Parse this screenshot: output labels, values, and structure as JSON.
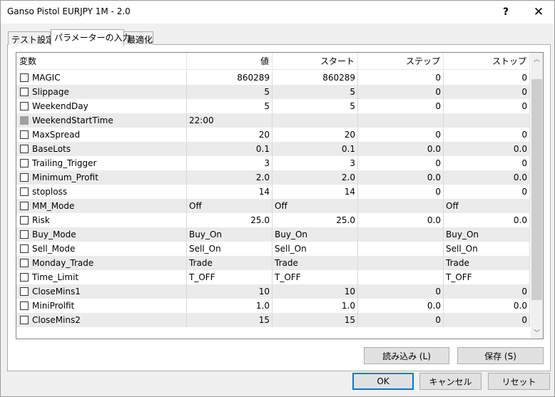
{
  "window": {
    "title": "Ganso Pistol EURJPY 1M - 2.0",
    "help_glyph": "?",
    "close_glyph": "✕"
  },
  "tabs": [
    {
      "label": "テスト設定"
    },
    {
      "label": "パラメーターの入力"
    },
    {
      "label": "最適化"
    }
  ],
  "grid": {
    "headers": {
      "name": "変数",
      "value": "値",
      "start": "スタート",
      "step": "ステップ",
      "stop": "ストップ"
    },
    "rows": [
      {
        "name": "MAGIC",
        "value": "860289",
        "start": "860289",
        "step": "0",
        "stop": "0",
        "align": "num",
        "checked": false,
        "disabled": false
      },
      {
        "name": "Slippage",
        "value": "5",
        "start": "5",
        "step": "0",
        "stop": "0",
        "align": "num",
        "checked": false,
        "disabled": false
      },
      {
        "name": "WeekendDay",
        "value": "5",
        "start": "5",
        "step": "0",
        "stop": "0",
        "align": "num",
        "checked": false,
        "disabled": false
      },
      {
        "name": "WeekendStartTime",
        "value": "22:00",
        "start": "",
        "step": "",
        "stop": "",
        "align": "text",
        "checked": false,
        "disabled": true
      },
      {
        "name": "MaxSpread",
        "value": "20",
        "start": "20",
        "step": "0",
        "stop": "0",
        "align": "num",
        "checked": false,
        "disabled": false
      },
      {
        "name": "BaseLots",
        "value": "0.1",
        "start": "0.1",
        "step": "0.0",
        "stop": "0.0",
        "align": "num",
        "checked": false,
        "disabled": false
      },
      {
        "name": "Trailing_Trigger",
        "value": "3",
        "start": "3",
        "step": "0",
        "stop": "0",
        "align": "num",
        "checked": false,
        "disabled": false
      },
      {
        "name": "Minimum_Profit",
        "value": "2.0",
        "start": "2.0",
        "step": "0.0",
        "stop": "0.0",
        "align": "num",
        "checked": false,
        "disabled": false
      },
      {
        "name": "stoploss",
        "value": "14",
        "start": "14",
        "step": "0",
        "stop": "0",
        "align": "num",
        "checked": false,
        "disabled": false
      },
      {
        "name": "MM_Mode",
        "value": "Off",
        "start": "Off",
        "step": "",
        "stop": "Off",
        "align": "text",
        "checked": false,
        "disabled": false
      },
      {
        "name": "Risk",
        "value": "25.0",
        "start": "25.0",
        "step": "0.0",
        "stop": "0.0",
        "align": "num",
        "checked": false,
        "disabled": false
      },
      {
        "name": "Buy_Mode",
        "value": "Buy_On",
        "start": "Buy_On",
        "step": "",
        "stop": "Buy_On",
        "align": "text",
        "checked": false,
        "disabled": false
      },
      {
        "name": "Sell_Mode",
        "value": "Sell_On",
        "start": "Sell_On",
        "step": "",
        "stop": "Sell_On",
        "align": "text",
        "checked": false,
        "disabled": false
      },
      {
        "name": "Monday_Trade",
        "value": "Trade",
        "start": "Trade",
        "step": "",
        "stop": "Trade",
        "align": "text",
        "checked": false,
        "disabled": false
      },
      {
        "name": "Time_Limit",
        "value": "T_OFF",
        "start": "T_OFF",
        "step": "",
        "stop": "T_OFF",
        "align": "text",
        "checked": false,
        "disabled": false
      },
      {
        "name": "CloseMins1",
        "value": "10",
        "start": "10",
        "step": "0",
        "stop": "0",
        "align": "num",
        "checked": false,
        "disabled": false
      },
      {
        "name": "MiniProlfit",
        "value": "1.0",
        "start": "1.0",
        "step": "0.0",
        "stop": "0.0",
        "align": "num",
        "checked": false,
        "disabled": false
      },
      {
        "name": "CloseMins2",
        "value": "15",
        "start": "15",
        "step": "0",
        "stop": "0",
        "align": "num",
        "checked": false,
        "disabled": false
      }
    ]
  },
  "scrollbar": {
    "up_glyph": "︿",
    "down_glyph": "﹀"
  },
  "buttons": {
    "load": "読み込み (L)",
    "save": "保存 (S)",
    "ok": "OK",
    "cancel": "キャンセル",
    "reset": "リセット"
  }
}
